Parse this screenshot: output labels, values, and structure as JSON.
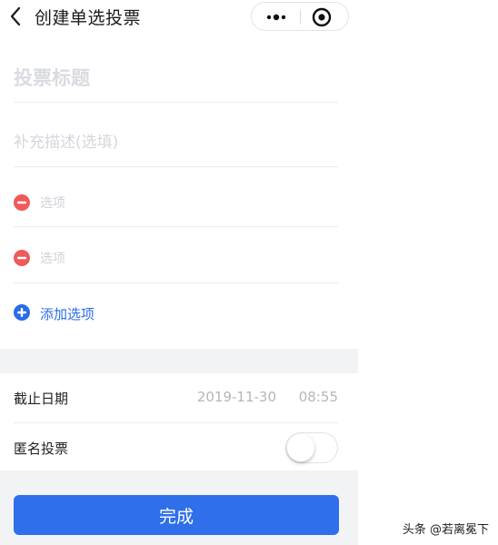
{
  "header": {
    "title": "创建单选投票",
    "back_icon": "chevron-left-icon",
    "more_icon": "more-dots-icon",
    "close_icon": "record-circle-icon"
  },
  "form": {
    "title_placeholder": "投票标题",
    "description_placeholder": "补充描述(选填)",
    "options": [
      {
        "placeholder": "选项"
      },
      {
        "placeholder": "选项"
      }
    ],
    "add_option_label": "添加选项"
  },
  "settings": {
    "deadline_label": "截止日期",
    "deadline_date": "2019-11-30",
    "deadline_time": "08:55",
    "anonymous_label": "匿名投票",
    "anonymous_enabled": false
  },
  "actions": {
    "done_label": "完成"
  },
  "watermark": "头条 @若离冕下",
  "colors": {
    "accent": "#2f6fe9",
    "remove": "#f05a5a",
    "band": "#f2f3f5"
  }
}
